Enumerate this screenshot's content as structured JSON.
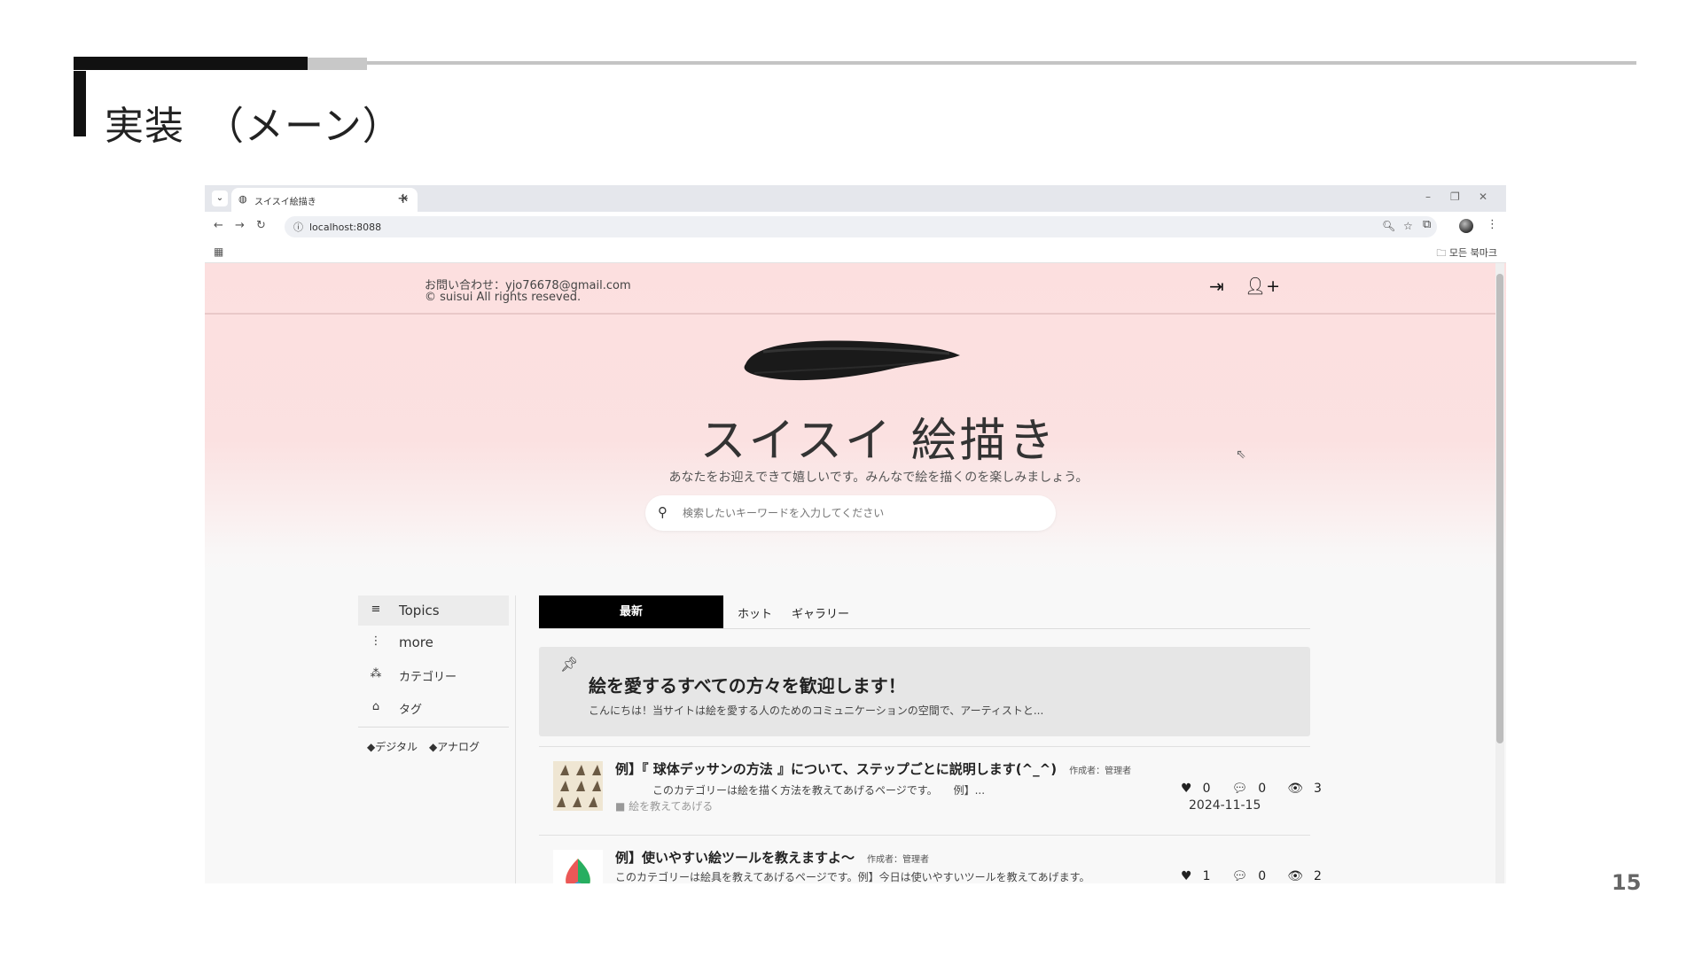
{
  "slide": {
    "title": "実装　（メーン）",
    "page_number": "15"
  },
  "browser": {
    "tab_title": "スイスイ絵描き",
    "url": "localhost:8088",
    "bookmarks_all": "모든 북마크"
  },
  "site": {
    "contact": "お問い合わせ：yjo76678@gmail.com",
    "copyright": "© suisui All rights reseved.",
    "title": "スイスイ 絵描き",
    "tagline": "あなたをお迎えできて嬉しいです。みんなで絵を描くのを楽しみましょう。",
    "search_placeholder": "検索したいキーワードを入力してください"
  },
  "sidebar": {
    "items": [
      {
        "label": "Topics",
        "icon": "list-icon"
      },
      {
        "label": "more",
        "icon": "more-vertical-icon"
      },
      {
        "label": "カテゴリー",
        "icon": "shapes-icon"
      },
      {
        "label": "タグ",
        "icon": "tags-icon"
      }
    ],
    "tags": [
      "デジタル",
      "アナログ"
    ]
  },
  "tabs": {
    "latest": "最新",
    "hot": "ホット",
    "gallery": "ギャラリー"
  },
  "pinned": {
    "title": "絵を愛するすべての方々を歓迎します！",
    "body": "こんにちは！当サイトは絵を愛する人のためのコミュニケーションの空間で、アーティストと..."
  },
  "posts": [
    {
      "title": "例】『 球体デッサンの方法 』について、ステップごとに説明します(^_^)",
      "author": "作成者：管理者",
      "excerpt": "このカテゴリーは絵を描く方法を教えてあげるページです。　　例】...",
      "category": "絵を教えてあげる",
      "likes": "0",
      "comments": "0",
      "views": "3",
      "date": "2024-11-15"
    },
    {
      "title": "例】使いやすい絵ツールを教えますよ～",
      "author": "作成者：管理者",
      "excerpt": "このカテゴリーは絵具を教えてあげるページです。例】今日は使いやすいツールを教えてあげます。",
      "likes": "1",
      "comments": "0",
      "views": "2"
    }
  ]
}
